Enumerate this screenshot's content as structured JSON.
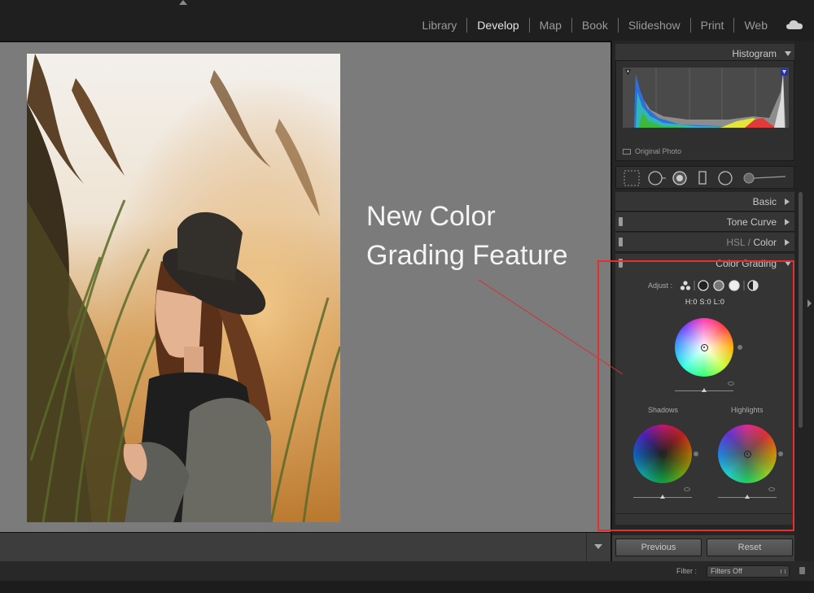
{
  "modules": [
    "Library",
    "Develop",
    "Map",
    "Book",
    "Slideshow",
    "Print",
    "Web"
  ],
  "active_module": "Develop",
  "annotation": {
    "line1": "New Color",
    "line2": "Grading Feature"
  },
  "panels": {
    "histogram": "Histogram",
    "original_photo": "Original Photo",
    "basic": "Basic",
    "tone_curve": "Tone Curve",
    "hsl_part": "HSL",
    "slash": " / ",
    "color_part": "Color",
    "color_grading": "Color Grading"
  },
  "color_grading": {
    "adjust_label": "Adjust :",
    "readout": "H:0 S:0 L:0",
    "shadows": "Shadows",
    "highlights": "Highlights"
  },
  "buttons": {
    "previous": "Previous",
    "reset": "Reset"
  },
  "filter": {
    "label": "Filter :",
    "value": "Filters Off"
  },
  "colors": {
    "annotation_red": "#e53030"
  }
}
